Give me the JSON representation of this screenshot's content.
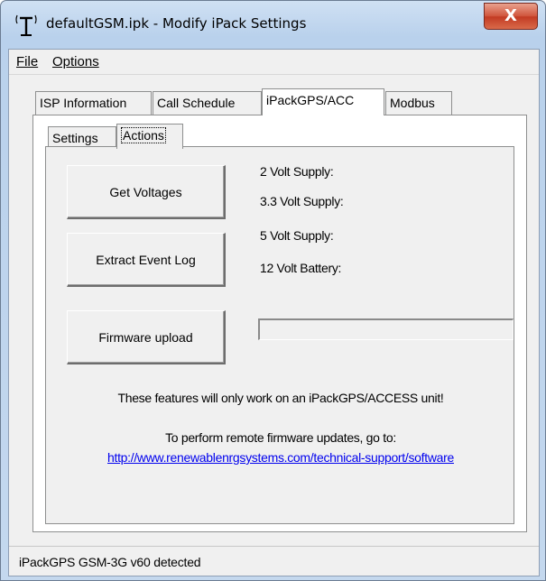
{
  "window": {
    "title": "defaultGSM.ipk - Modify iPack Settings",
    "close_glyph": "X",
    "icon": "antenna-icon"
  },
  "menu": [
    {
      "label": "File"
    },
    {
      "label": "Options"
    }
  ],
  "tabs": [
    {
      "label": "ISP Information",
      "active": false
    },
    {
      "label": "Call Schedule",
      "active": false
    },
    {
      "label": "iPackGPS/ACC",
      "active": true
    },
    {
      "label": "Modbus",
      "active": false
    }
  ],
  "subtabs": [
    {
      "label": "Settings",
      "active": false
    },
    {
      "label": "Actions",
      "active": true
    }
  ],
  "actions": {
    "get_voltages": "Get Voltages",
    "extract_event_log": "Extract Event Log",
    "firmware_upload": "Firmware upload",
    "voltages": [
      "2 Volt Supply:",
      "3.3 Volt Supply:",
      "5 Volt Supply:",
      "12 Volt Battery:"
    ],
    "upload_progress": 0,
    "note": "These features will only work on an iPackGPS/ACCESS unit!",
    "remote_note": "To perform remote firmware updates, go to:",
    "link": "http://www.renewablenrgsystems.com/technical-support/software"
  },
  "status": {
    "text": "iPackGPS GSM-3G v60 detected"
  },
  "colors": {
    "close_button": "#c23a22",
    "link": "#0000ee",
    "window_frame": "#b9d1ec"
  }
}
